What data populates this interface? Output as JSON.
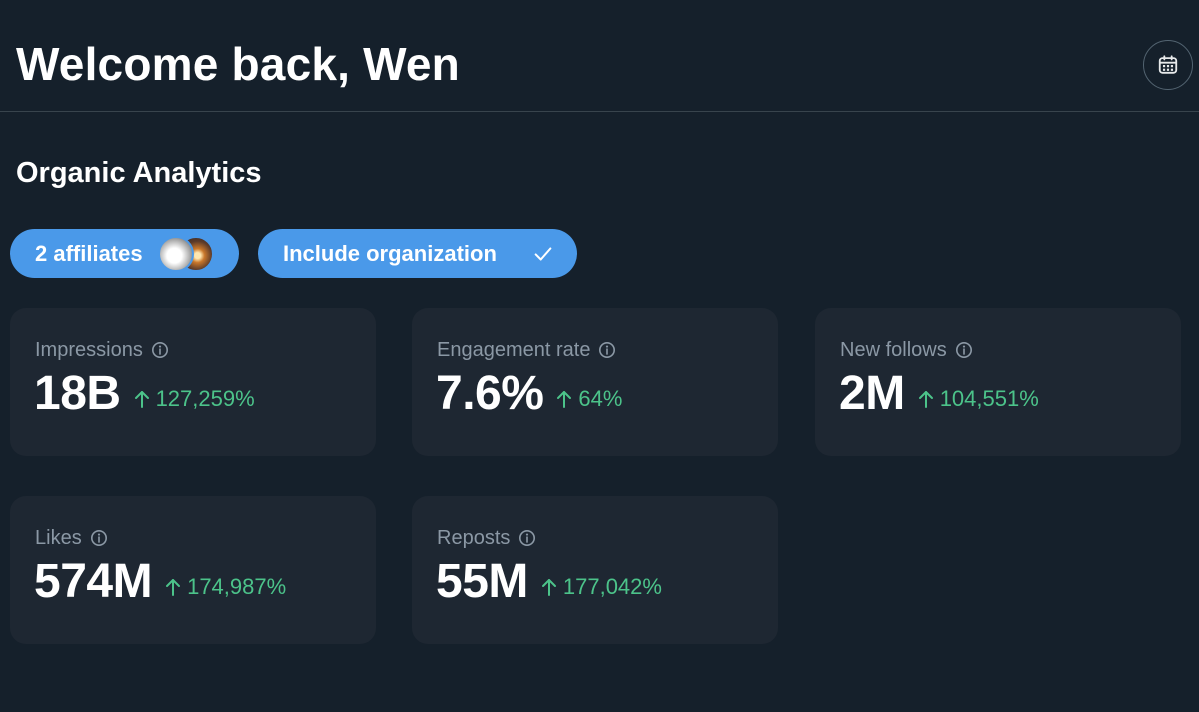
{
  "header": {
    "title": "Welcome back, Wen",
    "calendar_icon": "calendar-icon"
  },
  "section": {
    "title": "Organic Analytics"
  },
  "filters": {
    "affiliates_label": "2 affiliates",
    "include_org_label": "Include organization",
    "include_org_checked": true,
    "accent_color": "#4a99e9"
  },
  "metrics": [
    {
      "label": "Impressions",
      "value": "18B",
      "delta": "127,259%"
    },
    {
      "label": "Engagement rate",
      "value": "7.6%",
      "delta": "64%"
    },
    {
      "label": "New follows",
      "value": "2M",
      "delta": "104,551%"
    },
    {
      "label": "Likes",
      "value": "574M",
      "delta": "174,987%"
    },
    {
      "label": "Reposts",
      "value": "55M",
      "delta": "177,042%"
    }
  ],
  "colors": {
    "background": "#15202b",
    "card": "#1e2732",
    "positive_delta": "#4cc38a",
    "muted_text": "#8b98a5"
  }
}
